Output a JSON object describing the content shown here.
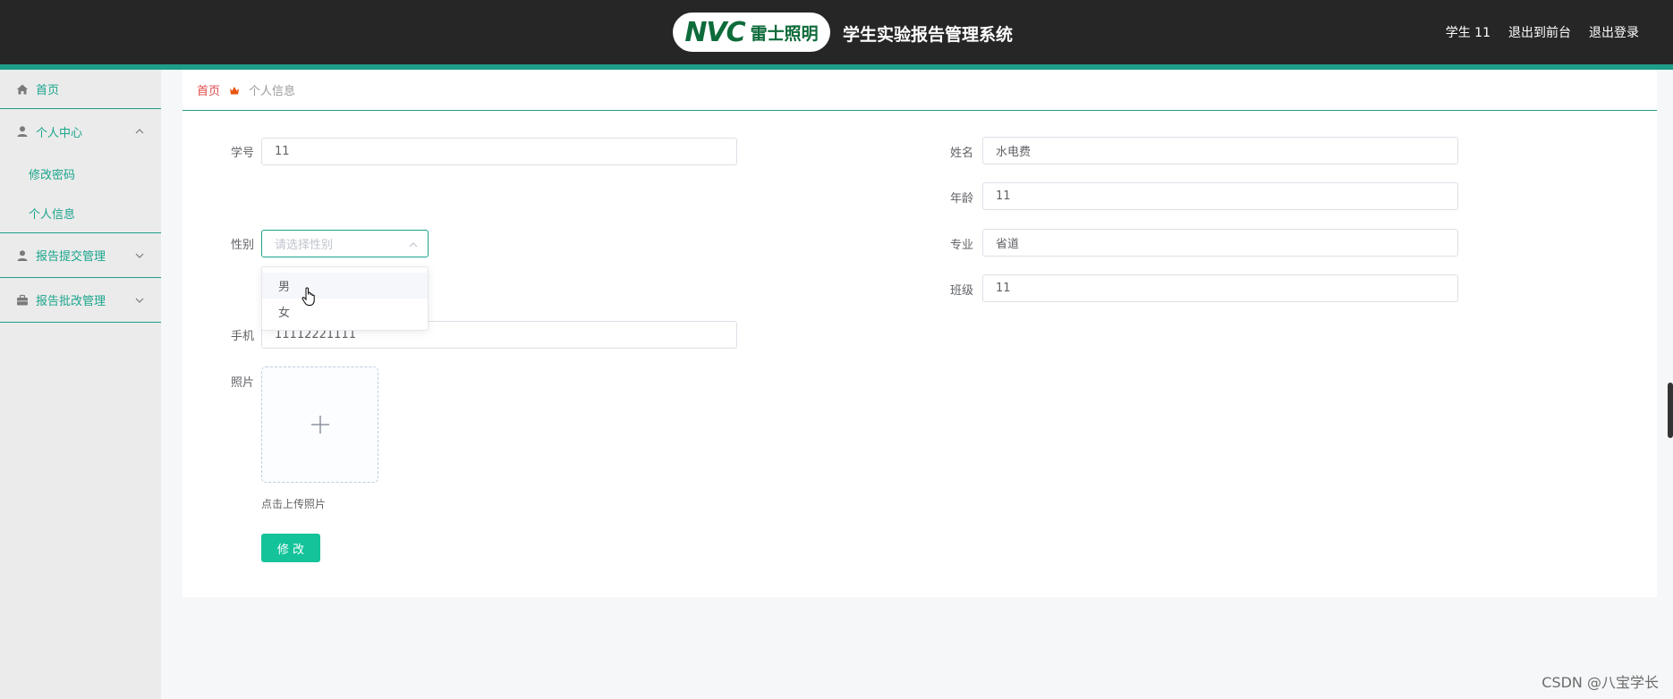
{
  "header": {
    "logo_mark": "NVC",
    "logo_brand": "雷士照明",
    "app_title": "学生实验报告管理系统",
    "user_label": "学生 11",
    "back_to_front": "退出到前台",
    "logout": "退出登录"
  },
  "sidebar": {
    "home": "首页",
    "personal_center": "个人中心",
    "change_password": "修改密码",
    "personal_info": "个人信息",
    "report_submit": "报告提交管理",
    "report_review": "报告批改管理"
  },
  "breadcrumb": {
    "home": "首页",
    "current": "个人信息"
  },
  "form": {
    "student_no_label": "学号",
    "student_no_value": "11",
    "name_label": "姓名",
    "name_value": "水电费",
    "age_label": "年龄",
    "age_value": "11",
    "gender_label": "性别",
    "gender_placeholder": "请选择性别",
    "major_label": "专业",
    "major_value": "省道",
    "class_label": "班级",
    "class_value": "11",
    "phone_label": "手机",
    "phone_value": "11112221111",
    "photo_label": "照片",
    "upload_tip": "点击上传照片",
    "submit": "修 改"
  },
  "gender_options": [
    "男",
    "女"
  ],
  "watermark": "CSDN @八宝学长",
  "colors": {
    "topbar": "#262626",
    "accent": "#1e9e8a",
    "button": "#14c39a",
    "breadcrumb_home": "#e04a4a"
  }
}
